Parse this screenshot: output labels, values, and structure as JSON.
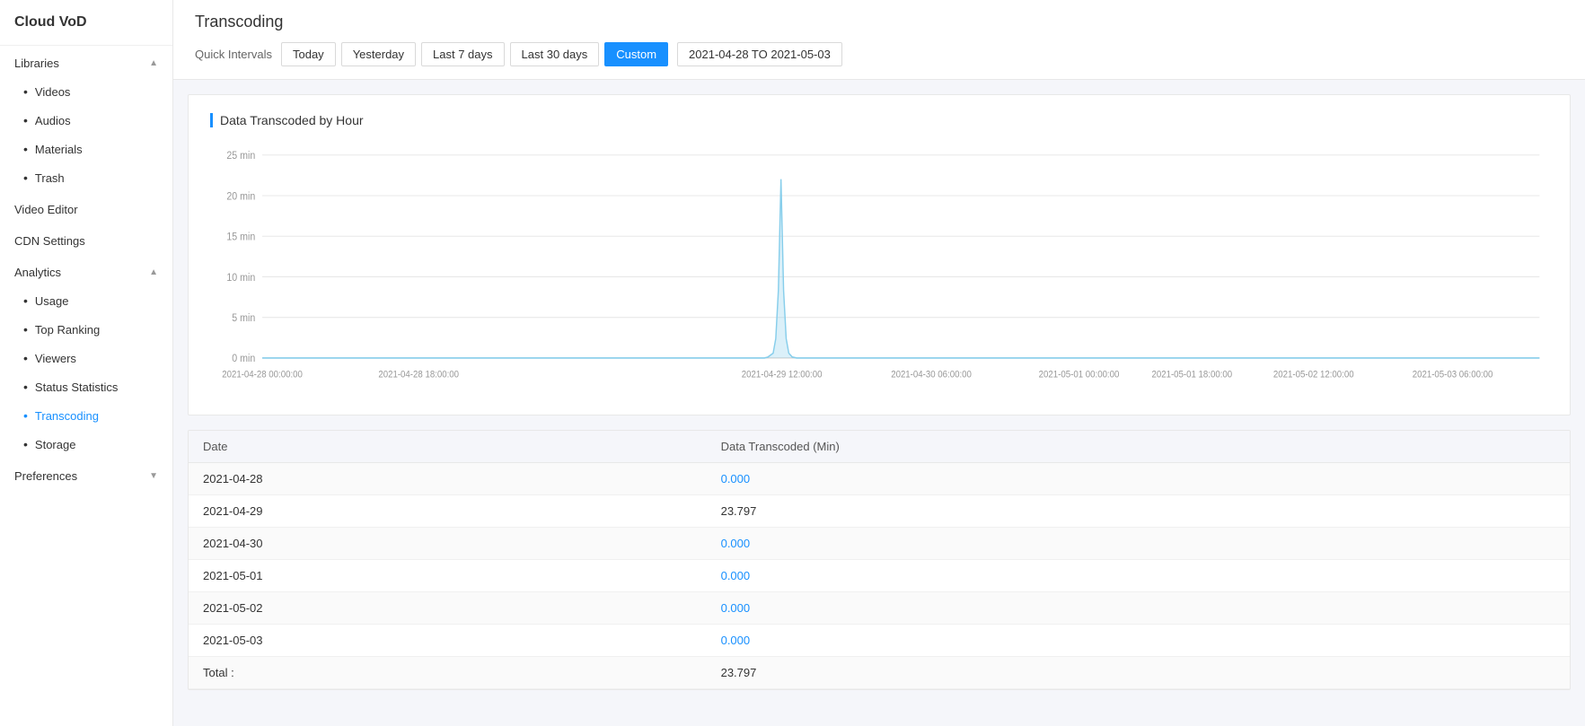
{
  "app": {
    "title": "Cloud VoD"
  },
  "sidebar": {
    "libraries_label": "Libraries",
    "libraries_expanded": true,
    "libraries_items": [
      {
        "label": "Videos",
        "active": false
      },
      {
        "label": "Audios",
        "active": false
      },
      {
        "label": "Materials",
        "active": false
      },
      {
        "label": "Trash",
        "active": false
      }
    ],
    "video_editor_label": "Video Editor",
    "cdn_settings_label": "CDN Settings",
    "analytics_label": "Analytics",
    "analytics_expanded": true,
    "analytics_items": [
      {
        "label": "Usage",
        "active": false
      },
      {
        "label": "Top Ranking",
        "active": false
      },
      {
        "label": "Viewers",
        "active": false
      },
      {
        "label": "Status Statistics",
        "active": false
      },
      {
        "label": "Transcoding",
        "active": true
      },
      {
        "label": "Storage",
        "active": false
      }
    ],
    "preferences_label": "Preferences"
  },
  "header": {
    "title": "Transcoding",
    "quick_intervals_label": "Quick Intervals",
    "buttons": [
      {
        "label": "Today",
        "active": false
      },
      {
        "label": "Yesterday",
        "active": false
      },
      {
        "label": "Last 7 days",
        "active": false
      },
      {
        "label": "Last 30 days",
        "active": false
      },
      {
        "label": "Custom",
        "active": true
      }
    ],
    "date_range": "2021-04-28 TO 2021-05-03"
  },
  "chart": {
    "title": "Data Transcoded by Hour",
    "y_labels": [
      "25 min",
      "20 min",
      "15 min",
      "10 min",
      "5 min",
      "0 min"
    ],
    "x_labels": [
      "2021-04-28 00:00:00",
      "2021-04-28 18:00:00",
      "2021-04-29 12:00:00",
      "2021-04-30 06:00:00",
      "2021-05-01 00:00:00",
      "2021-05-01 18:00:00",
      "2021-05-02 12:00:00",
      "2021-05-03 06:00:00"
    ]
  },
  "table": {
    "col1": "Date",
    "col2": "Data Transcoded (Min)",
    "rows": [
      {
        "date": "2021-04-28",
        "value": "0.000",
        "zero": true
      },
      {
        "date": "2021-04-29",
        "value": "23.797",
        "zero": false
      },
      {
        "date": "2021-04-30",
        "value": "0.000",
        "zero": true
      },
      {
        "date": "2021-05-01",
        "value": "0.000",
        "zero": true
      },
      {
        "date": "2021-05-02",
        "value": "0.000",
        "zero": true
      },
      {
        "date": "2021-05-03",
        "value": "0.000",
        "zero": true
      }
    ],
    "total_label": "Total :",
    "total_value": "23.797"
  }
}
